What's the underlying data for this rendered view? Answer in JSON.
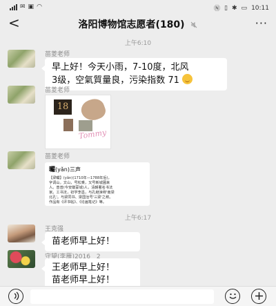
{
  "status_bar": {
    "time": "10:11",
    "left_icons": [
      "signal-icon",
      "notification-icon",
      "message-icon",
      "wifi-icon"
    ],
    "right_icons": [
      "nfc-icon",
      "vibrate-icon",
      "bluetooth-icon",
      "battery-icon"
    ]
  },
  "header": {
    "title": "洛阳博物馆志愿者(180)",
    "back_label": "<",
    "more_label": "···"
  },
  "messages": [
    {
      "type": "time",
      "text": "上午6:10"
    },
    {
      "type": "text",
      "sender": "苗菱老师",
      "lines": [
        "早上好！今天小雨，7-10度，北风",
        "3级，空氣質量良，污染指数 71"
      ],
      "emoji": "smiley-icon"
    },
    {
      "type": "image",
      "sender": "苗菱老师",
      "tile_label": "18"
    },
    {
      "type": "card",
      "sender": "苗菱老师",
      "title": "曮",
      "pinyin": "(yǎn)三声",
      "body": [
        "【梁曮】(yǎn)(1710年—1788年后)，",
        "字调山，文山，号松乘，又号新城圃来",
        "人。曾曾(今安徽蒙城)人，清朝著名书法",
        "家。工书法，初学李邕，与孔继涑称'南梁",
        "北孔'。与梁同书、梁国治号'三梁'之称。",
        "作品有《评书帖》、《论画笔记》等。"
      ]
    },
    {
      "type": "time",
      "text": "上午6:17"
    },
    {
      "type": "text",
      "sender": "王克强",
      "lines": [
        "苗老师早上好！"
      ]
    },
    {
      "type": "text",
      "sender": "守望(李雁)2016＿2",
      "lines": [
        "王老师早上好！",
        "苗老师早上好！"
      ]
    }
  ],
  "input_bar": {
    "voice_icon": "voice-icon",
    "emoji_icon": "emoji-icon",
    "add_icon": "add-icon"
  }
}
